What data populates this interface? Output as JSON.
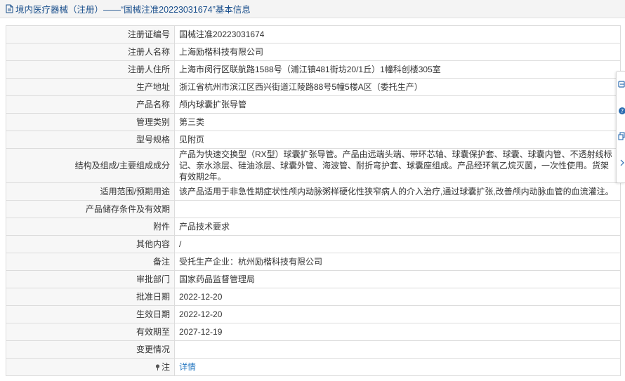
{
  "header": {
    "title": "境内医疗器械（注册）——“国械注准20223031674”基本信息"
  },
  "rows": [
    {
      "label": "注册证编号",
      "value": "国械注准20223031674"
    },
    {
      "label": "注册人名称",
      "value": "上海励楷科技有限公司"
    },
    {
      "label": "注册人住所",
      "value": "上海市闵行区联航路1588号（浦江镇481街坊20/1丘）1幢科创楼305室"
    },
    {
      "label": "生产地址",
      "value": "浙江省杭州市滨江区西兴街道江陵路88号5幢5楼A区（委托生产）"
    },
    {
      "label": "产品名称",
      "value": "颅内球囊扩张导管"
    },
    {
      "label": "管理类别",
      "value": "第三类"
    },
    {
      "label": "型号规格",
      "value": "见附页"
    },
    {
      "label": "结构及组成/主要组成成分",
      "value": "产品为快速交换型（RX型）球囊扩张导管。产品由远端头端、带环芯轴、球囊保护套、球囊、球囊内管、不透射线标记、亲水涂层、硅油涂层、球囊外管、海波管、耐折弯护套、球囊座组成。产品经环氧乙烷灭菌，一次性使用。货架有效期2年。"
    },
    {
      "label": "适用范围/预期用途",
      "value": "该产品适用于非急性期症状性颅内动脉粥样硬化性狭窄病人的介入治疗,通过球囊扩张,改善颅内动脉血管的血流灌注。"
    },
    {
      "label": "产品储存条件及有效期",
      "value": ""
    },
    {
      "label": "附件",
      "value": "产品技术要求"
    },
    {
      "label": "其他内容",
      "value": "/"
    },
    {
      "label": "备注",
      "value": "受托生产企业：杭州励楷科技有限公司"
    },
    {
      "label": "审批部门",
      "value": "国家药品监督管理局"
    },
    {
      "label": "批准日期",
      "value": "2022-12-20"
    },
    {
      "label": "生效日期",
      "value": "2022-12-20"
    },
    {
      "label": "有效期至",
      "value": "2027-12-19"
    },
    {
      "label": "变更情况",
      "value": ""
    },
    {
      "label": "注",
      "value": "详情"
    }
  ],
  "icons": {
    "header": "document-icon",
    "note": "pin-icon",
    "sidebar": [
      "window-icon",
      "help-icon",
      "copy-icon",
      "chevron-right-icon"
    ]
  },
  "colors": {
    "header_text": "#1a4f8c",
    "link": "#2a7ac2",
    "sidebar_blue": "#2b6cb0"
  }
}
